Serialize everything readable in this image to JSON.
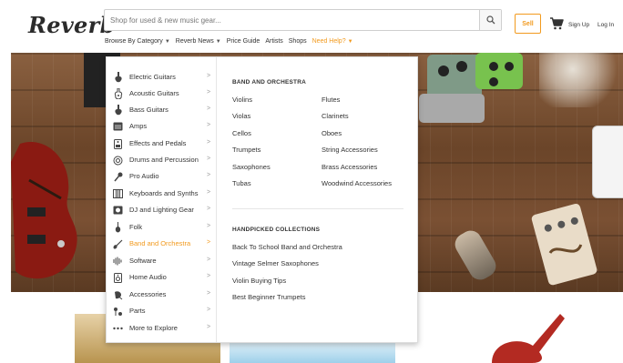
{
  "brand": {
    "logo_text": "Reverb",
    "accent": "#f29a1e"
  },
  "search": {
    "placeholder": "Shop for used & new music gear..."
  },
  "nav": {
    "browse_label": "Browse By Category",
    "news_label": "Reverb News",
    "price_guide": "Price Guide",
    "artists": "Artists",
    "shops": "Shops",
    "help": "Need Help?"
  },
  "account": {
    "sell": "Sell",
    "sign_up": "Sign Up",
    "log_in": "Log In"
  },
  "categories": [
    {
      "label": "Electric Guitars",
      "icon": "electric-guitar-icon"
    },
    {
      "label": "Acoustic Guitars",
      "icon": "acoustic-guitar-icon"
    },
    {
      "label": "Bass Guitars",
      "icon": "bass-guitar-icon"
    },
    {
      "label": "Amps",
      "icon": "amp-icon"
    },
    {
      "label": "Effects and Pedals",
      "icon": "pedal-icon"
    },
    {
      "label": "Drums and Percussion",
      "icon": "drum-icon"
    },
    {
      "label": "Pro Audio",
      "icon": "microphone-icon"
    },
    {
      "label": "Keyboards and Synths",
      "icon": "keyboard-icon"
    },
    {
      "label": "DJ and Lighting Gear",
      "icon": "dj-icon"
    },
    {
      "label": "Folk",
      "icon": "folk-icon"
    },
    {
      "label": "Band and Orchestra",
      "icon": "violin-icon",
      "active": true
    },
    {
      "label": "Software",
      "icon": "software-icon"
    },
    {
      "label": "Home Audio",
      "icon": "speaker-icon"
    },
    {
      "label": "Accessories",
      "icon": "accessories-icon"
    },
    {
      "label": "Parts",
      "icon": "parts-icon"
    },
    {
      "label": "More to Explore",
      "icon": "more-icon"
    }
  ],
  "submenu": {
    "band_heading": "BAND AND ORCHESTRA",
    "col1": [
      "Violins",
      "Violas",
      "Cellos",
      "Trumpets",
      "Saxophones",
      "Tubas"
    ],
    "col2": [
      "Flutes",
      "Clarinets",
      "Oboes",
      "String Accessories",
      "Brass Accessories",
      "Woodwind Accessories"
    ],
    "collections_heading": "HANDPICKED COLLECTIONS",
    "collections": [
      "Back To School Band and Orchestra",
      "Vintage Selmer Saxophones",
      "Violin Buying Tips",
      "Best Beginner Trumpets"
    ]
  }
}
